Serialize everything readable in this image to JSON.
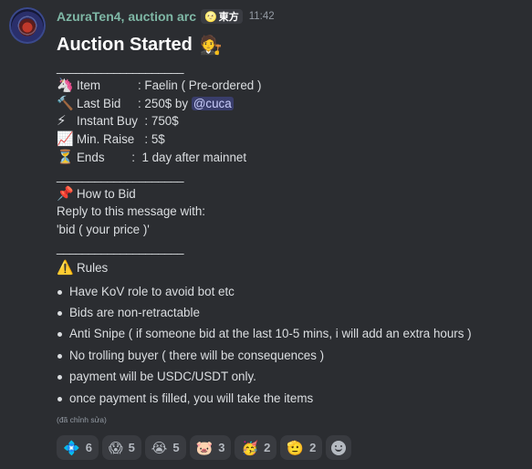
{
  "message": {
    "author": "AzuraTen4, auction arc",
    "tag": {
      "emoji": "🌝",
      "label": "東方"
    },
    "timestamp": "11:42",
    "title": "Auction Started",
    "title_emoji": "🧑‍⚖️",
    "divider": "____________________",
    "fields": [
      {
        "icon": "🦄",
        "text": "Item           : Faelin ( Pre-ordered )"
      },
      {
        "icon": "🔨",
        "text": "Last Bid     : 250$ by ",
        "mention": "@cuca"
      },
      {
        "icon": "⚡",
        "text": "Instant Buy  : 750$"
      },
      {
        "icon": "📈",
        "text": "Min. Raise   : 5$"
      },
      {
        "icon": "⏳",
        "text": "Ends        :  1 day after mainnet"
      }
    ],
    "how_to_bid": {
      "icon": "📌",
      "heading": "How to Bid",
      "line1": "Reply to this message with:",
      "line2": "'bid ( your price )'"
    },
    "rules": {
      "icon": "⚠️",
      "heading": "Rules",
      "items": [
        "Have KoV role to avoid bot etc",
        "Bids are non-retractable",
        "Anti Snipe ( if someone bid at the last 10-5 mins, i will add an extra hours )",
        "No trolling buyer ( there will be consequences )",
        "payment will be USDC/USDT only.",
        "once payment is filled, you will take the items"
      ]
    },
    "edited_label": "(đã chỉnh sửa)"
  },
  "reactions": [
    {
      "emoji": "💠",
      "count": "6"
    },
    {
      "emoji": "😱",
      "count": "5"
    },
    {
      "emoji": "😭",
      "count": "5"
    },
    {
      "emoji": "🐷",
      "count": "3"
    },
    {
      "emoji": "🥳",
      "count": "2"
    },
    {
      "emoji": "🫡",
      "count": "2"
    }
  ],
  "colors": {
    "background": "#2b2d31",
    "username": "#7fb8a6",
    "mention_bg": "#5865f2",
    "reaction_bg": "#393b40"
  }
}
